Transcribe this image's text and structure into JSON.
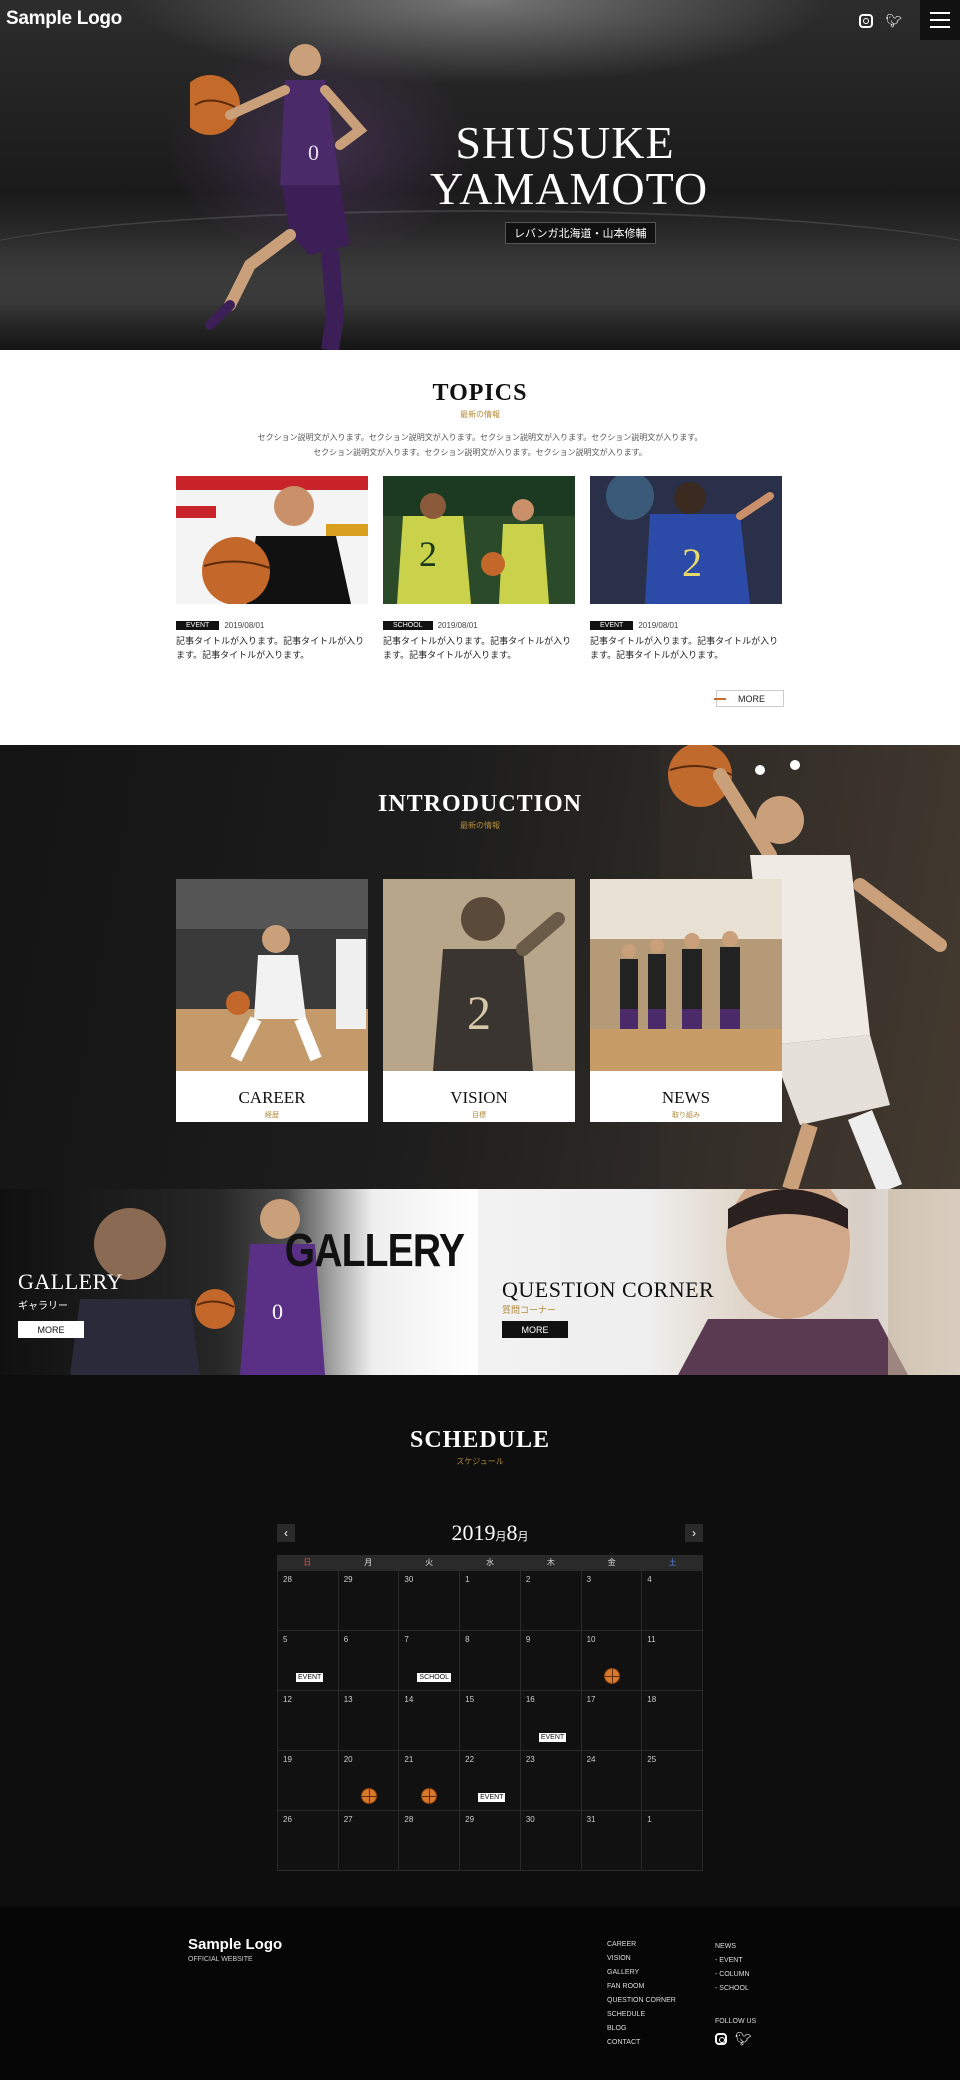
{
  "header": {
    "logo": "Sample Logo",
    "icons": [
      "instagram-icon",
      "twitter-icon",
      "menu-icon"
    ]
  },
  "hero": {
    "title": "SHUSUKE YAMAMOTO",
    "subtitle": "レバンガ北海道・山本修輔"
  },
  "topics": {
    "title": "TOPICS",
    "subtitle": "最新の情報",
    "description_line1": "セクション説明文が入ります。セクション説明文が入ります。セクション説明文が入ります。セクション説明文が入ります。",
    "description_line2": "セクション説明文が入ります。セクション説明文が入ります。セクション説明文が入ります。",
    "items": [
      {
        "tag": "EVENT",
        "date": "2019/08/01",
        "title": "記事タイトルが入ります。記事タイトルが入ります。記事タイトルが入ります。"
      },
      {
        "tag": "SCHOOL",
        "date": "2019/08/01",
        "title": "記事タイトルが入ります。記事タイトルが入ります。記事タイトルが入ります。"
      },
      {
        "tag": "EVENT",
        "date": "2019/08/01",
        "title": "記事タイトルが入ります。記事タイトルが入ります。記事タイトルが入ります。"
      }
    ],
    "more": "MORE"
  },
  "introduction": {
    "title": "INTRODUCTION",
    "subtitle": "最新の情報",
    "cards": [
      {
        "label": "CAREER",
        "jp": "経歴"
      },
      {
        "label": "VISION",
        "jp": "目標"
      },
      {
        "label": "NEWS",
        "jp": "取り組み"
      }
    ]
  },
  "gallery": {
    "banner_word": "GALLERY",
    "title": "GALLERY",
    "jp": "ギャラリー",
    "more": "MORE"
  },
  "question": {
    "title": "QUESTION CORNER",
    "jp": "質問コーナー",
    "more": "MORE"
  },
  "schedule": {
    "title": "SCHEDULE",
    "subtitle": "スケジュール",
    "year": "2019",
    "year_unit": "月",
    "month": "8",
    "month_unit": "月",
    "prev": "‹",
    "next": "›",
    "weekdays": [
      "日",
      "月",
      "火",
      "水",
      "木",
      "金",
      "土"
    ],
    "weeks": [
      [
        {
          "d": "28"
        },
        {
          "d": "29"
        },
        {
          "d": "30"
        },
        {
          "d": "1"
        },
        {
          "d": "2"
        },
        {
          "d": "3"
        },
        {
          "d": "4"
        }
      ],
      [
        {
          "d": "5",
          "ev": "EVENT"
        },
        {
          "d": "6"
        },
        {
          "d": "7",
          "ev": "SCHOOL"
        },
        {
          "d": "8"
        },
        {
          "d": "9"
        },
        {
          "d": "10",
          "ball": true
        },
        {
          "d": "11"
        }
      ],
      [
        {
          "d": "12"
        },
        {
          "d": "13"
        },
        {
          "d": "14"
        },
        {
          "d": "15"
        },
        {
          "d": "16",
          "ev": "EVENT"
        },
        {
          "d": "17"
        },
        {
          "d": "18"
        }
      ],
      [
        {
          "d": "19"
        },
        {
          "d": "20",
          "ball": true
        },
        {
          "d": "21",
          "ball": true
        },
        {
          "d": "22",
          "ev": "EVENT"
        },
        {
          "d": "23"
        },
        {
          "d": "24"
        },
        {
          "d": "25"
        }
      ],
      [
        {
          "d": "26"
        },
        {
          "d": "27"
        },
        {
          "d": "28"
        },
        {
          "d": "29"
        },
        {
          "d": "30"
        },
        {
          "d": "31"
        },
        {
          "d": "1"
        }
      ]
    ]
  },
  "footer": {
    "logo": "Sample Logo",
    "sub": "OFFICIAL WEBSITE",
    "nav": [
      "CAREER",
      "VISION",
      "GALLERY",
      "FAN ROOM",
      "QUESTION CORNER",
      "SCHEDULE",
      "BLOG",
      "CONTACT"
    ],
    "nav2": [
      "NEWS",
      "- EVENT",
      "- COLUMN",
      "- SCHOOL"
    ],
    "follow": "FOLLOW US"
  },
  "colors": {
    "accent": "#b08a3a",
    "dark": "#0e0e0e",
    "sunday": "#d9534f",
    "saturday": "#5b7bd9"
  }
}
